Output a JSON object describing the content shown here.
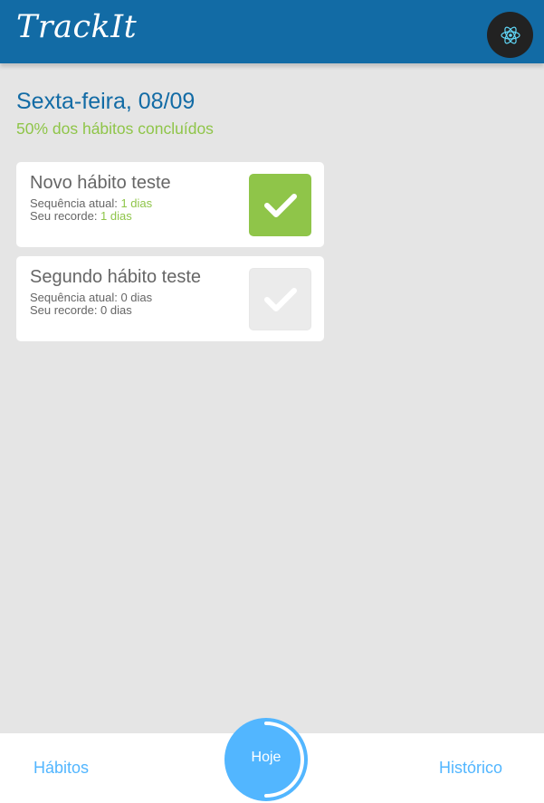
{
  "header": {
    "logo": "TrackIt",
    "avatar_icon": "react-atom-icon"
  },
  "today": {
    "title": "Sexta-feira, 08/09",
    "progress_text": "50% dos hábitos concluídos"
  },
  "habits": [
    {
      "name": "Novo hábito teste",
      "current_label": "Sequência atual: ",
      "current_value": "1 dias",
      "record_label": "Seu recorde: ",
      "record_value": "1 dias",
      "done": true
    },
    {
      "name": "Segundo hábito teste",
      "current_label": "Sequência atual: ",
      "current_value": "0 dias",
      "record_label": "Seu recorde: ",
      "record_value": "0 dias",
      "done": false
    }
  ],
  "footer": {
    "habits_link": "Hábitos",
    "today_button": "Hoje",
    "history_link": "Histórico",
    "today_progress": 0.5
  },
  "colors": {
    "header": "#126ba5",
    "accent_blue": "#52b6ff",
    "done_green": "#8fc549",
    "background": "#e5e5e5",
    "text_gray": "#666666"
  }
}
